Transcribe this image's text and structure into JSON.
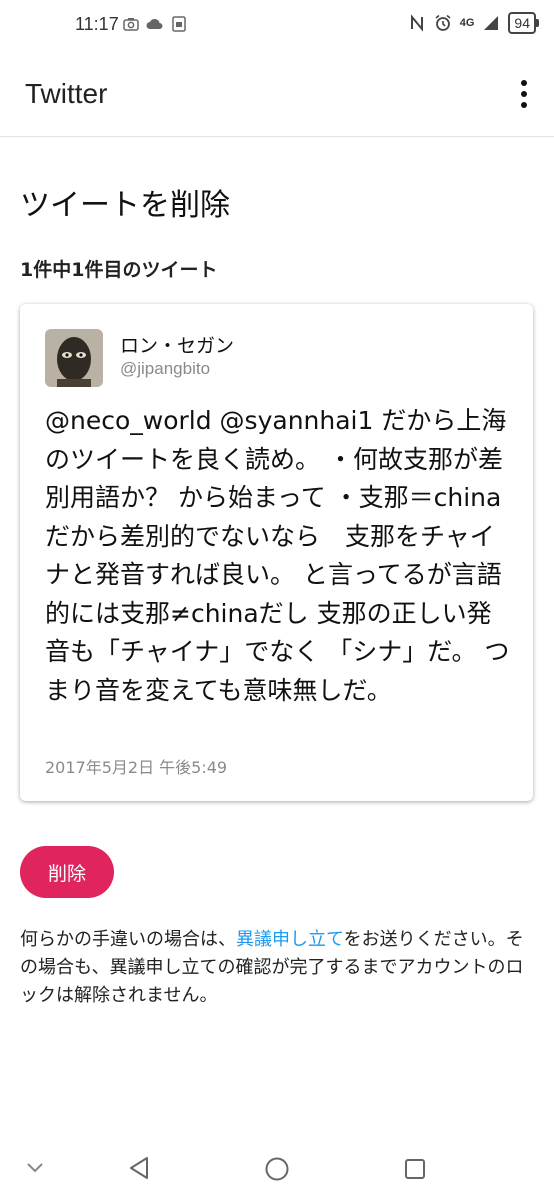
{
  "status_bar": {
    "time": "11:17",
    "network": "4G",
    "battery": "94"
  },
  "app_bar": {
    "title": "Twitter"
  },
  "page": {
    "title": "ツイートを削除",
    "tweet_count": "1件中1件目のツイート"
  },
  "tweet": {
    "user_name": "ロン・セガン",
    "handle": "@jipangbito",
    "text": "@neco_world @syannhai1 だから上海のツイートを良く読め。 ・何故支那が差別用語か？ から始まって ・支那＝chinaだから差別的でないなら　支那をチャイナと発音すれば良い。 と言ってるが言語的には支那≠chinaだし 支那の正しい発音も「チャイナ」でなく 「シナ」だ。 つまり音を変えても意味無しだ。",
    "date": "2017年5月2日 午後5:49"
  },
  "actions": {
    "delete_label": "削除"
  },
  "notice": {
    "before": "何らかの手違いの場合は、",
    "link": "異議申し立て",
    "after": "をお送りください。その場合も、異議申し立ての確認が完了するまでアカウントのロックは解除されません。"
  },
  "colors": {
    "accent": "#e0245e",
    "link": "#1d9bf0"
  },
  "icons": [
    "camera-icon",
    "cloud-icon",
    "sim-icon",
    "nfc-icon",
    "alarm-icon",
    "signal-icon",
    "more-vert-icon",
    "chevron-down-icon",
    "back-icon",
    "home-icon",
    "recents-icon"
  ]
}
